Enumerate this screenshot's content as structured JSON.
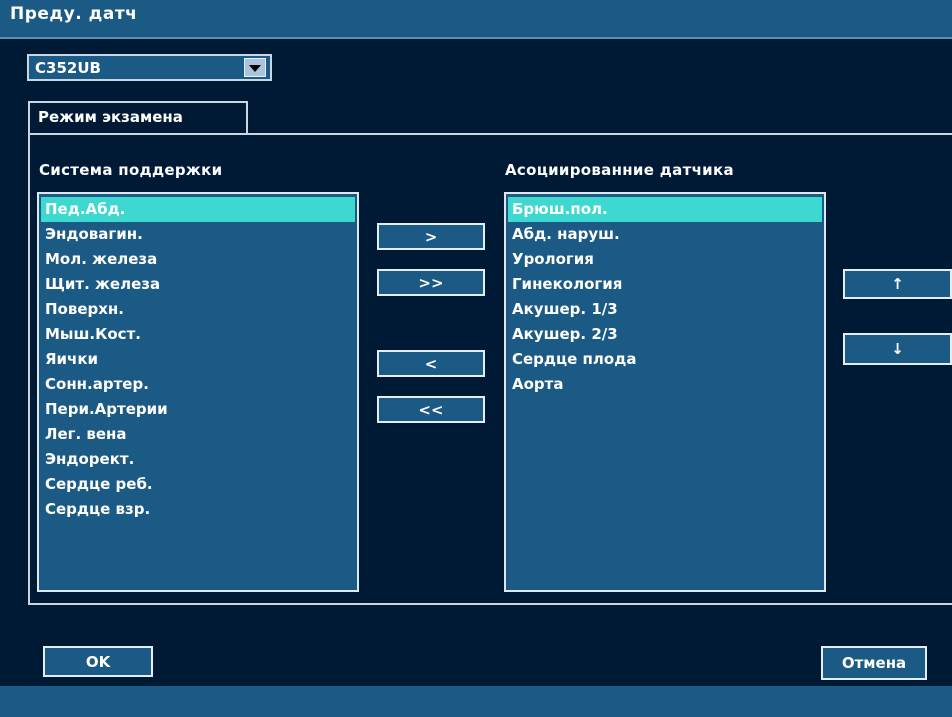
{
  "window": {
    "title": "Преду. датч"
  },
  "probe": {
    "selected": "C352UB"
  },
  "tab": {
    "label": "Режим экзамена"
  },
  "left_list": {
    "heading": "Система поддержки",
    "items": [
      "Пед.Абд.",
      "Эндовагин.",
      "Мол. железа",
      "Щит. железа",
      "Поверхн.",
      "Мыш.Кост.",
      "Яички",
      "Сонн.артер.",
      "Пери.Артерии",
      "Лег. вена",
      "Эндорект.",
      "Сердце реб.",
      "Сердце взр."
    ],
    "selected_index": 0
  },
  "right_list": {
    "heading": "Асоциированние датчика",
    "items": [
      "Брюш.пол.",
      "Абд. наруш.",
      "Урология",
      "Гинекология",
      "Акушер. 1/3",
      "Акушер. 2/3",
      "Сердце плода",
      "Аорта"
    ],
    "selected_index": 0
  },
  "transfer": {
    "add": ">",
    "add_all": ">>",
    "remove": "<",
    "remove_all": "<<"
  },
  "order": {
    "up": "↑",
    "down": "↓"
  },
  "footer": {
    "ok": "OK",
    "cancel": "Отмена"
  },
  "colors": {
    "background": "#001a36",
    "bar": "#1c5a86",
    "selection": "#3dd8d0",
    "border": "#e0e8ef"
  }
}
